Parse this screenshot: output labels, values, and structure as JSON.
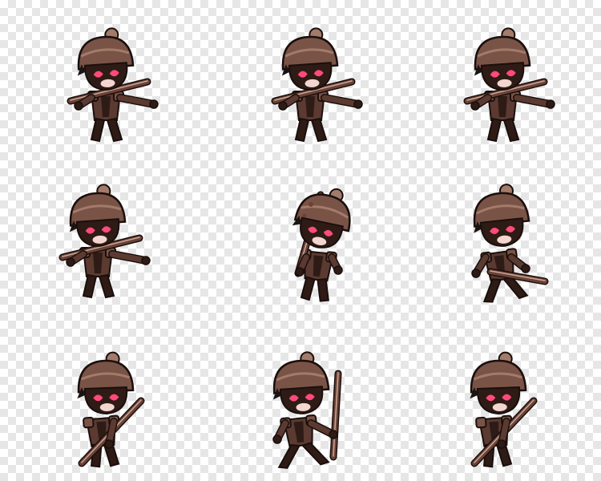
{
  "sprite_sheet": {
    "grid": {
      "rows": 3,
      "cols": 3
    },
    "character": {
      "colors": {
        "armor": "#5b3a31",
        "armor_dark": "#2e1b16",
        "helmet": "#7a5347",
        "helmet_light": "#a37b6b",
        "outline": "#1a0f0c",
        "eye_glow": "#ff4a7a",
        "skin": "#f3d6cf",
        "hair": "#1a1414",
        "blade": "#6b4236",
        "blade_edge": "#c9a79a",
        "highlight": "#ffffff"
      }
    },
    "frames": [
      {
        "name": "frame-1",
        "pose": "idle-blade-forward"
      },
      {
        "name": "frame-2",
        "pose": "idle-blade-forward"
      },
      {
        "name": "frame-3",
        "pose": "idle-blade-forward"
      },
      {
        "name": "frame-4",
        "pose": "idle-blade-forward"
      },
      {
        "name": "frame-5",
        "pose": "blade-raised-shout"
      },
      {
        "name": "frame-6",
        "pose": "run-blade-low"
      },
      {
        "name": "frame-7",
        "pose": "guard-blade-diagonal"
      },
      {
        "name": "frame-8",
        "pose": "lunge-blade-up"
      },
      {
        "name": "frame-9",
        "pose": "guard-blade-diagonal"
      }
    ]
  }
}
